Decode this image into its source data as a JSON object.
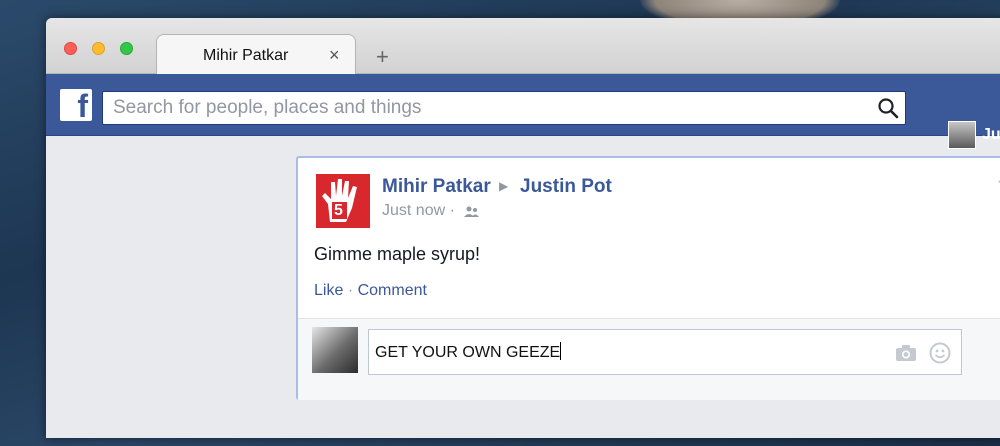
{
  "browser": {
    "tab_title": "Mihir Patkar",
    "close_tab_glyph": "×",
    "new_tab_glyph": "+"
  },
  "facebook": {
    "logo_letter": "f",
    "search_placeholder": "Search for people, places and things",
    "user_name_partial": "Ju"
  },
  "post": {
    "author": "Mihir Patkar",
    "target": "Justin Pot",
    "timestamp": "Just now ·",
    "text": "Gimme maple syrup!",
    "like_label": "Like",
    "separator": "·",
    "comment_label": "Comment",
    "page_avatar_number": "5"
  },
  "comment": {
    "draft_text": "GET YOUR OWN GEEZE"
  },
  "colors": {
    "brand": "#3b5998",
    "avatar_red": "#d8272d"
  },
  "icons": [
    "search-icon",
    "audience-icon",
    "chevron-down-icon",
    "camera-icon",
    "smiley-icon",
    "close-icon",
    "plus-icon"
  ]
}
